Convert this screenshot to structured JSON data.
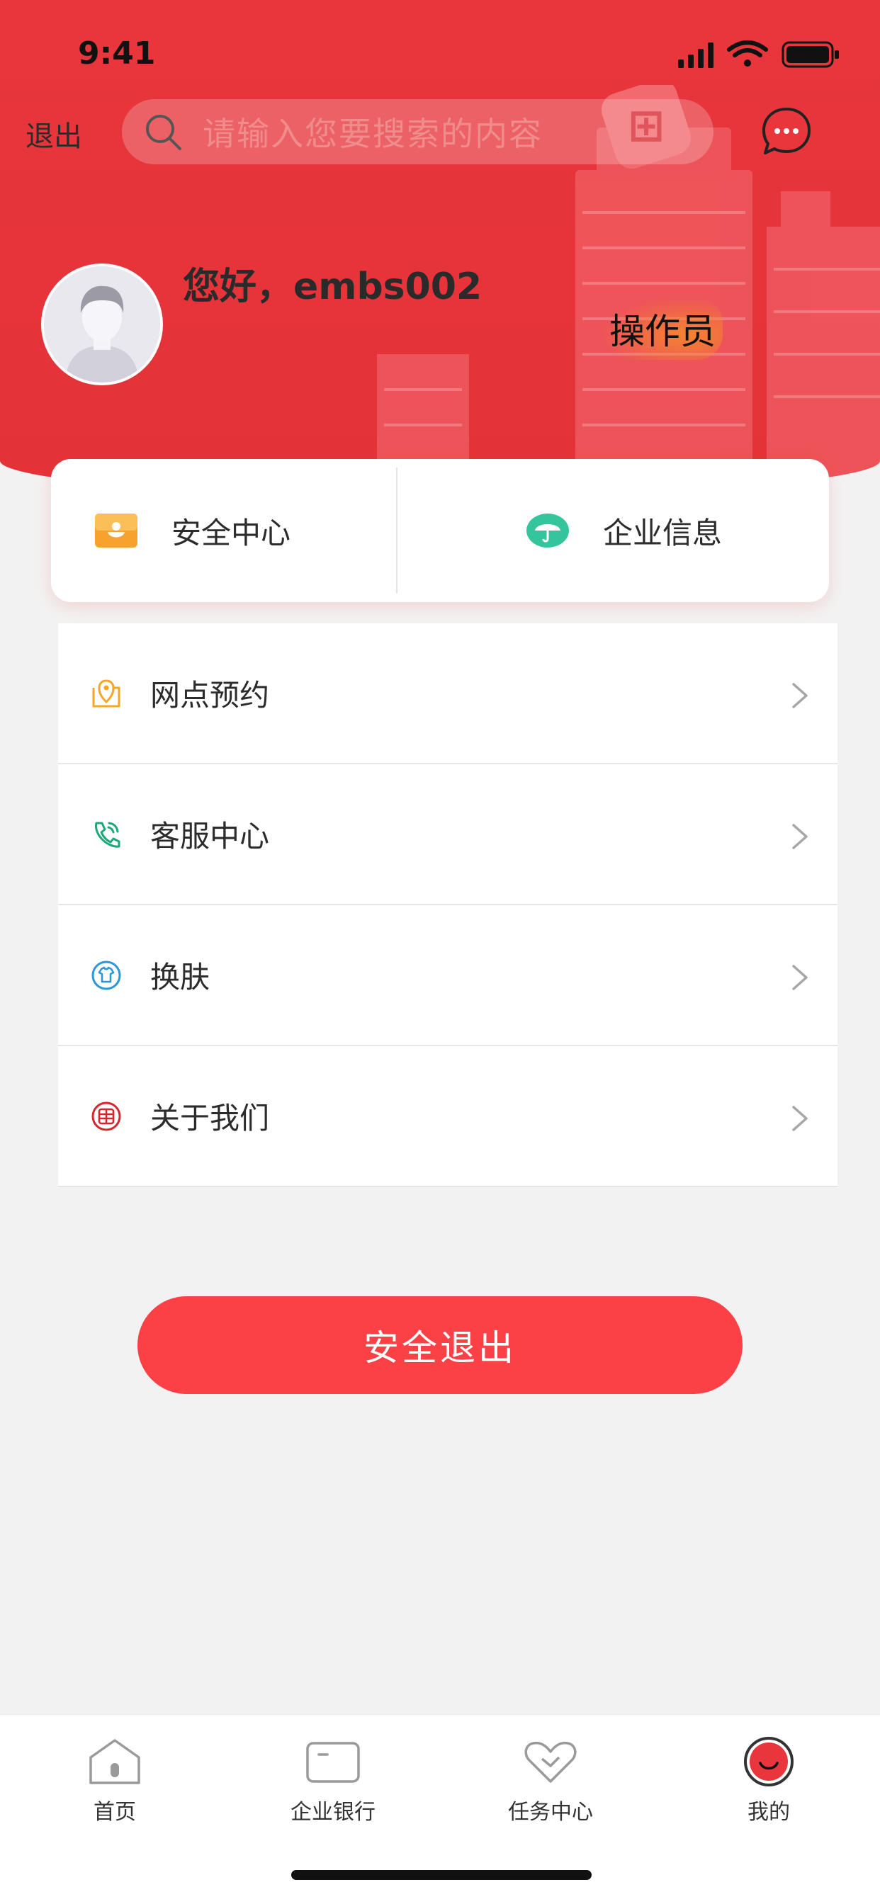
{
  "status_bar": {
    "time": "9:41"
  },
  "header": {
    "logout_label": "退出",
    "search_placeholder": "请输入您要搜索的内容",
    "greeting": "您好，embs002",
    "role": "操作员"
  },
  "quick_actions": [
    {
      "label": "安全中心",
      "icon": "safety-center-icon"
    },
    {
      "label": "企业信息",
      "icon": "umbrella-icon"
    }
  ],
  "menu": [
    {
      "label": "网点预约",
      "icon": "location-map-icon"
    },
    {
      "label": "客服中心",
      "icon": "phone-icon"
    },
    {
      "label": "换肤",
      "icon": "shirt-icon"
    },
    {
      "label": "关于我们",
      "icon": "bank-logo-icon"
    }
  ],
  "logout_button": "安全退出",
  "tabs": [
    {
      "label": "首页",
      "icon": "home-icon"
    },
    {
      "label": "企业银行",
      "icon": "card-icon"
    },
    {
      "label": "任务中心",
      "icon": "heart-icon"
    },
    {
      "label": "我的",
      "icon": "profile-icon",
      "active": true
    }
  ],
  "colors": {
    "primary": "#e8363c",
    "button": "#fc4146"
  }
}
